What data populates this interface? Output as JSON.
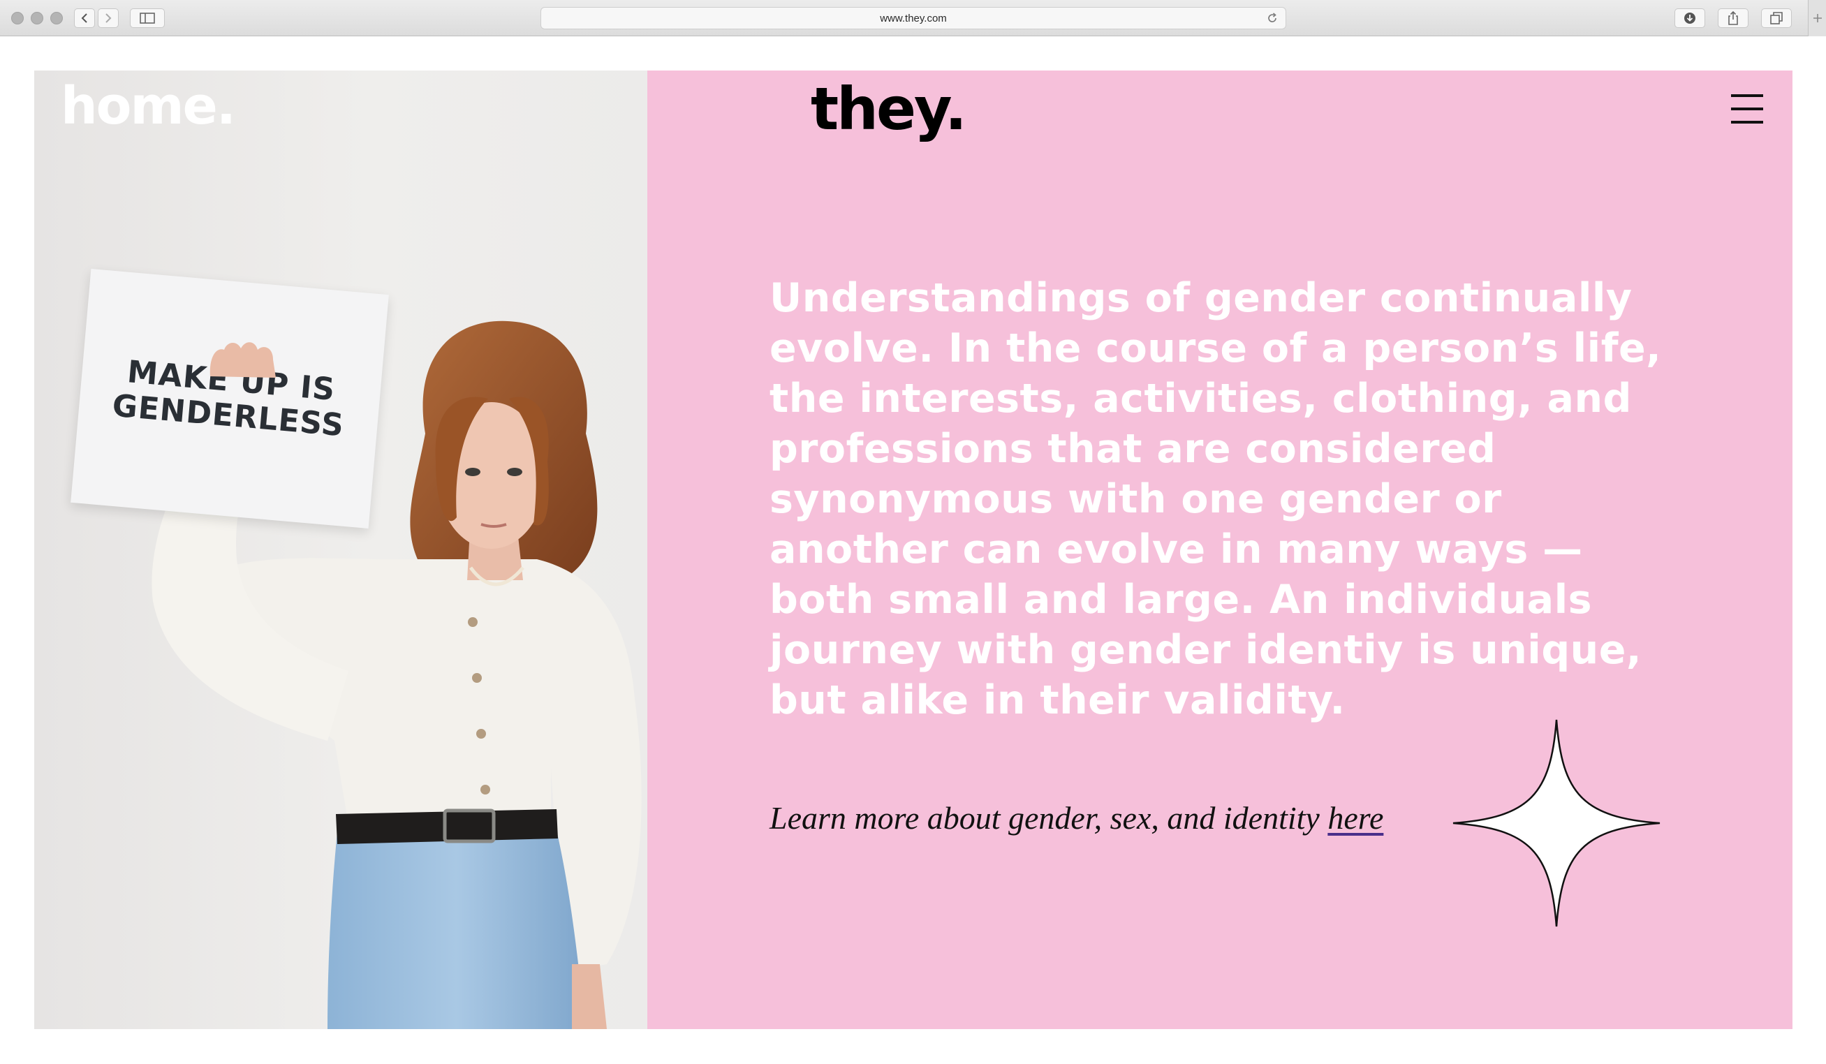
{
  "browser": {
    "url": "www.they.com"
  },
  "site": {
    "home_logo": "home.",
    "brand_logo": "they."
  },
  "photo": {
    "sign_line1": "MAKE UP IS",
    "sign_line2": "GENDERLESS"
  },
  "main": {
    "body_text": "Understandings of gender continually evolve. In the course of a person’s life, the interests, activities, clothing, and professions that are considered synonymous with one gender or another can evolve in many ways — both small and large. An individuals journey with gender identiy is unique, but alike in their validity.",
    "learn_more_text": "Learn more about gender, sex, and identity",
    "learn_more_link": "here"
  },
  "colors": {
    "panel_background": "#f6c0da",
    "body_text": "#ffffff",
    "logo": "#000000"
  }
}
